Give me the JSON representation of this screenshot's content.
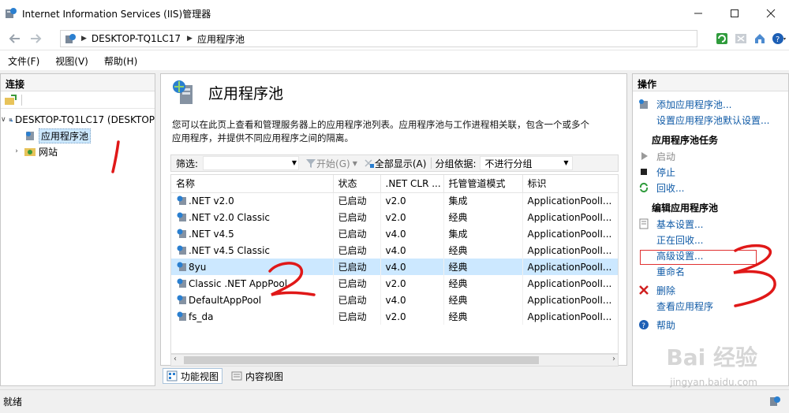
{
  "window": {
    "title": "Internet Information Services (IIS)管理器",
    "controls": [
      "minimize",
      "maximize",
      "close"
    ]
  },
  "address": {
    "crumbs": [
      "DESKTOP-TQ1LC17",
      "应用程序池"
    ]
  },
  "menu": {
    "items": [
      "文件(F)",
      "视图(V)",
      "帮助(H)"
    ]
  },
  "left": {
    "title": "连接",
    "tree": {
      "server": "DESKTOP-TQ1LC17 (DESKTOP",
      "pools": "应用程序池",
      "sites": "网站"
    }
  },
  "center": {
    "title": "应用程序池",
    "description_line1": "您可以在此页上查看和管理服务器上的应用程序池列表。应用程序池与工作进程相关联，包含一个或多个",
    "description_line2": "应用程序，并提供不同应用程序之间的隔离。",
    "filter": {
      "label": "筛选:",
      "start": "开始(G)",
      "show_all": "全部显示(A)",
      "group_label": "分组依据:",
      "group_value": "不进行分组"
    },
    "columns": [
      "名称",
      "状态",
      ".NET CLR ...",
      "托管管道模式",
      "标识"
    ],
    "rows": [
      {
        "name": ".NET v2.0",
        "status": "已启动",
        "clr": "v2.0",
        "mode": "集成",
        "identity": "ApplicationPoolI..."
      },
      {
        "name": ".NET v2.0 Classic",
        "status": "已启动",
        "clr": "v2.0",
        "mode": "经典",
        "identity": "ApplicationPoolI..."
      },
      {
        "name": ".NET v4.5",
        "status": "已启动",
        "clr": "v4.0",
        "mode": "集成",
        "identity": "ApplicationPoolI..."
      },
      {
        "name": ".NET v4.5 Classic",
        "status": "已启动",
        "clr": "v4.0",
        "mode": "经典",
        "identity": "ApplicationPoolI..."
      },
      {
        "name": "8yu",
        "status": "已启动",
        "clr": "v4.0",
        "mode": "经典",
        "identity": "ApplicationPoolI..."
      },
      {
        "name": "Classic .NET AppPool",
        "status": "已启动",
        "clr": "v2.0",
        "mode": "经典",
        "identity": "ApplicationPoolI..."
      },
      {
        "name": "DefaultAppPool",
        "status": "已启动",
        "clr": "v4.0",
        "mode": "经典",
        "identity": "ApplicationPoolI..."
      },
      {
        "name": "fs_da",
        "status": "已启动",
        "clr": "v2.0",
        "mode": "经典",
        "identity": "ApplicationPoolI..."
      }
    ],
    "selected_row": 4,
    "tabs": [
      "功能视图",
      "内容视图"
    ]
  },
  "right": {
    "title": "操作",
    "add_pool": "添加应用程序池...",
    "set_defaults": "设置应用程序池默认设置...",
    "tasks_title": "应用程序池任务",
    "start": "启动",
    "stop": "停止",
    "recycle": "回收...",
    "edit_title": "编辑应用程序池",
    "basic": "基本设置...",
    "recycling": "正在回收...",
    "advanced": "高级设置...",
    "rename": "重命名",
    "delete": "删除",
    "view_apps": "查看应用程序",
    "help": "帮助"
  },
  "status": {
    "text": "就绪"
  },
  "watermark": {
    "main": "Bai 经验",
    "sub": "jingyan.baidu.com"
  },
  "colors": {
    "selection": "#cce8ff",
    "link": "#0f5aa6",
    "annotation": "#e01818"
  }
}
